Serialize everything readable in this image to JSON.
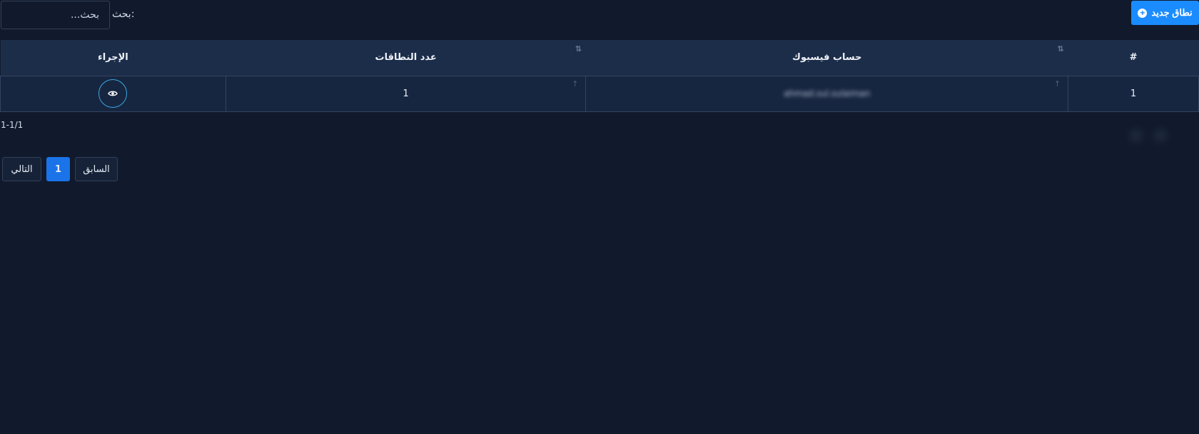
{
  "toolbar": {
    "new_button_label": "نطاق جديد",
    "search_label": "بحث:",
    "search_placeholder": "بحث..."
  },
  "table": {
    "headers": {
      "index": "#",
      "facebook_account": "حساب فيسبوك",
      "domain_count": "عدد النطاقات",
      "action": "الإجراء"
    },
    "rows": [
      {
        "index": "1",
        "facebook_account": "ahmad.sul.sulaiman",
        "domain_count": "1"
      }
    ]
  },
  "pagination": {
    "range": "1-1/1",
    "prev_label": "السابق",
    "current_page": "1",
    "next_label": "التالي"
  },
  "colors": {
    "background": "#111a2c",
    "header_bg": "#1c2d4a",
    "row_bg": "#172640",
    "accent": "#1a8cff",
    "active_page": "#1a73e8",
    "view_outline": "#3ba7e0"
  },
  "icons": [
    "plus-circle-icon",
    "sort-icon",
    "eye-icon"
  ]
}
